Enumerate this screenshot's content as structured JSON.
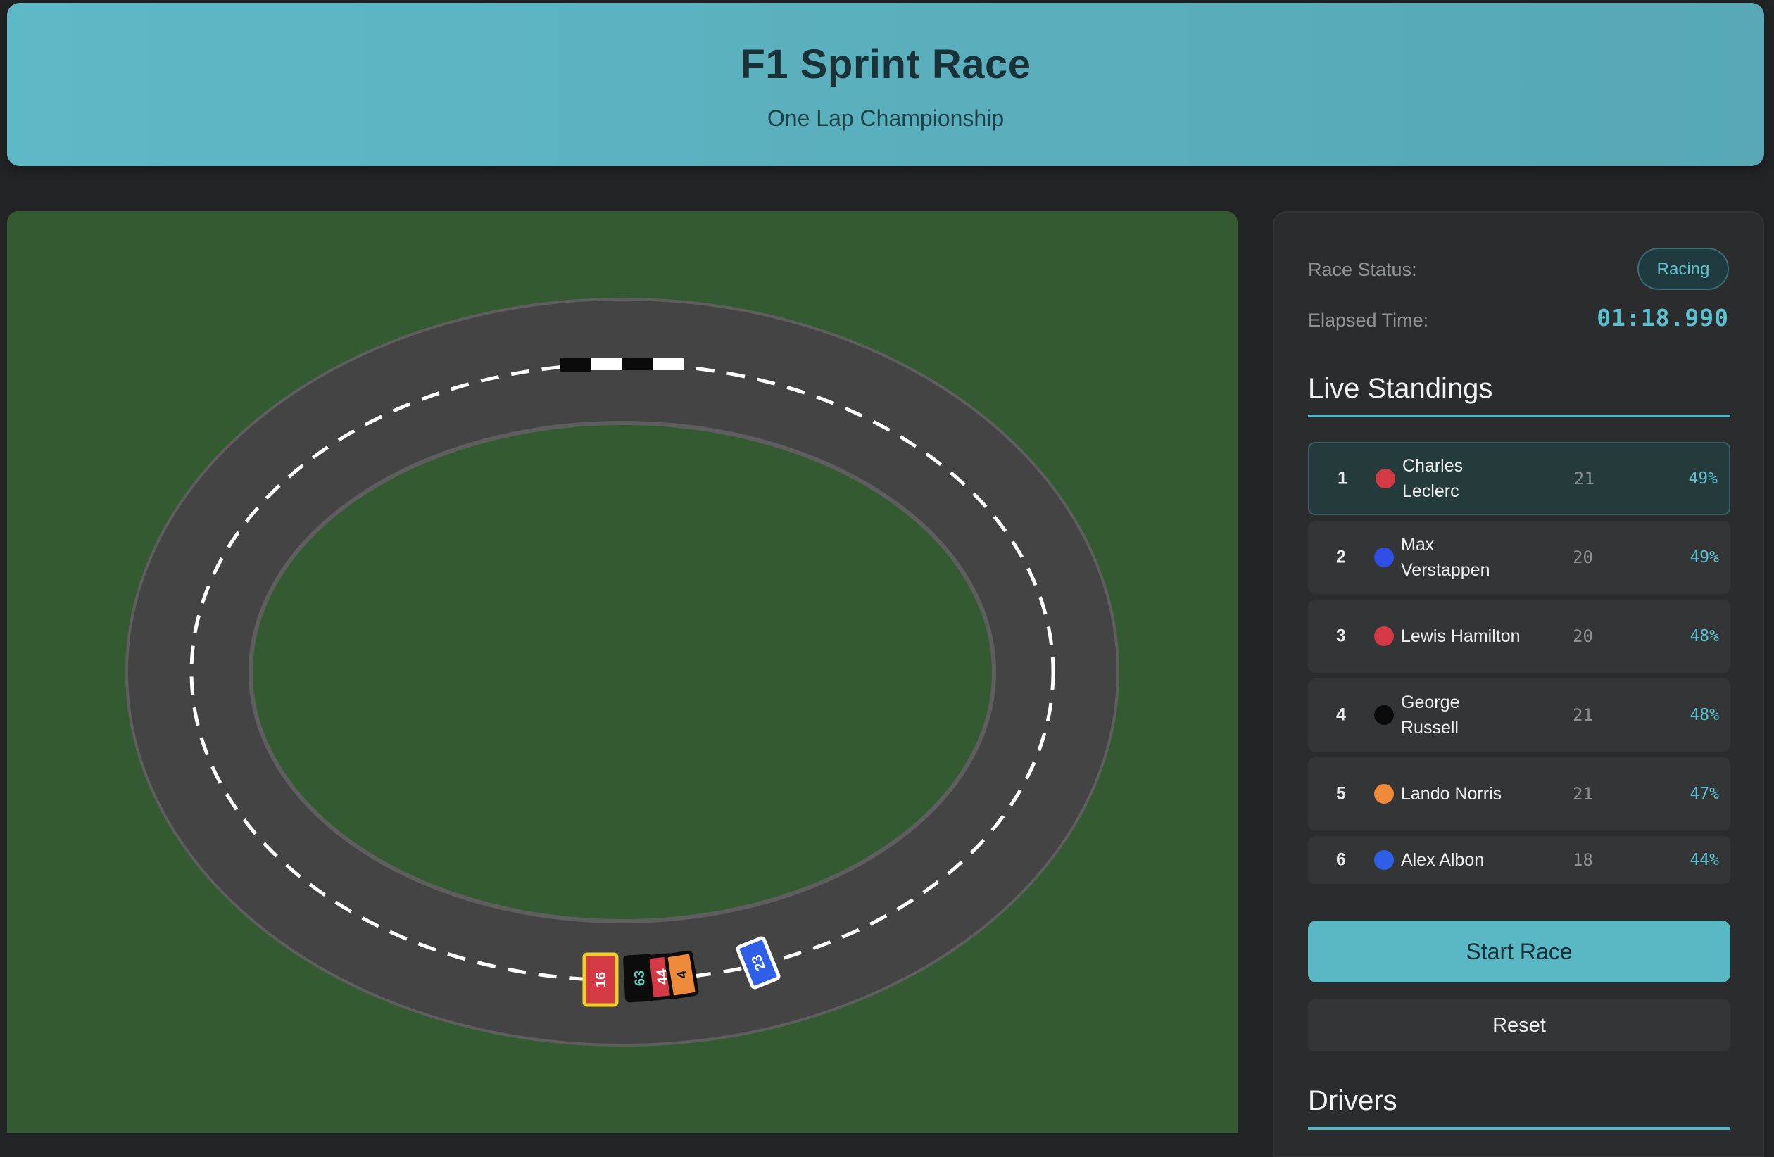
{
  "header": {
    "title": "F1 Sprint Race",
    "subtitle": "One Lap Championship"
  },
  "sidebar": {
    "race_status_label": "Race Status:",
    "race_status_value": "Racing",
    "elapsed_label": "Elapsed Time:",
    "elapsed_value": "01:18.990",
    "standings_title": "Live Standings",
    "drivers_title": "Drivers",
    "start_button": "Start Race",
    "reset_button": "Reset"
  },
  "standings": [
    {
      "pos": "1",
      "name": "Charles Leclerc",
      "laps": "21",
      "pct": "49%",
      "color": "#d33a45"
    },
    {
      "pos": "2",
      "name": "Max Verstappen",
      "laps": "20",
      "pct": "49%",
      "color": "#2f4fe6"
    },
    {
      "pos": "3",
      "name": "Lewis Hamilton",
      "laps": "20",
      "pct": "48%",
      "color": "#d33a45"
    },
    {
      "pos": "4",
      "name": "George Russell",
      "laps": "21",
      "pct": "48%",
      "color": "#0a0a0a"
    },
    {
      "pos": "5",
      "name": "Lando Norris",
      "laps": "21",
      "pct": "47%",
      "color": "#ee8a3a"
    },
    {
      "pos": "6",
      "name": "Alex Albon",
      "laps": "18",
      "pct": "44%",
      "color": "#2f5fe6"
    }
  ],
  "cars": [
    {
      "number": "16",
      "body": "#d33a45",
      "border": "#f2cf2b",
      "text": "#ffffff"
    },
    {
      "number": "63",
      "body": "#0c0c0c",
      "border": "#0c0c0c",
      "text": "#5ad0c0"
    },
    {
      "number": "44",
      "body": "#d33a45",
      "border": "#0c0c0c",
      "text": "#ffffff"
    },
    {
      "number": "4",
      "body": "#ee8a3a",
      "border": "#0c0c0c",
      "text": "#111111"
    },
    {
      "number": "23",
      "body": "#2f5fe6",
      "border": "#ffffff",
      "text": "#ffffff"
    }
  ],
  "colors": {
    "accent": "#5ab8c5",
    "grass": "#345a31",
    "asphalt": "#444445"
  }
}
